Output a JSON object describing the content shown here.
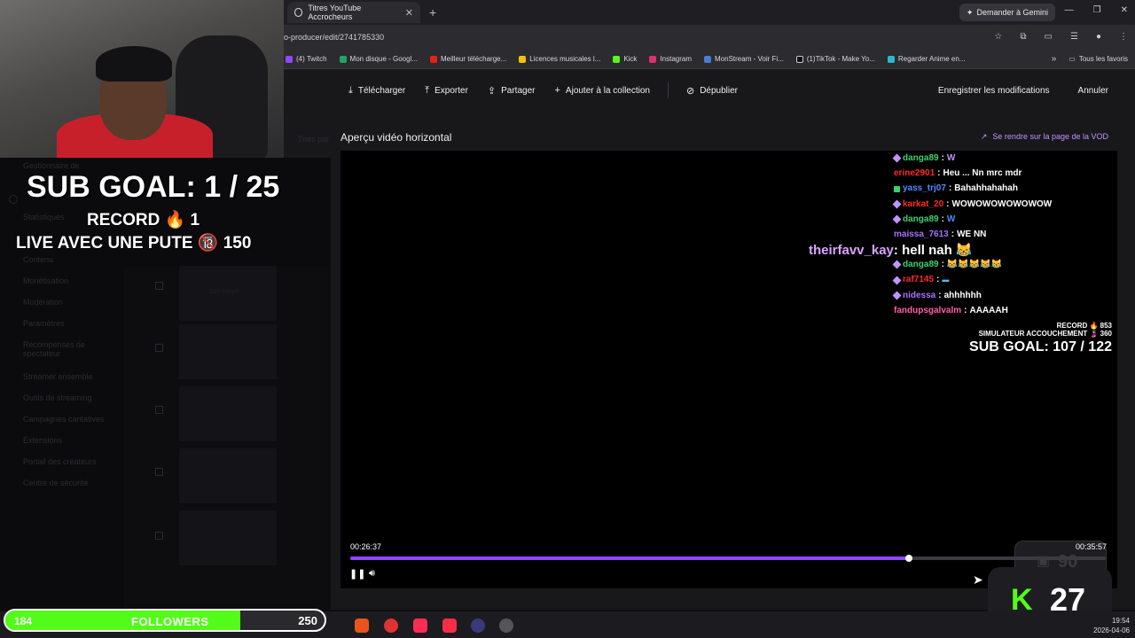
{
  "browser": {
    "tab_title": "Titres YouTube Accrocheurs",
    "gemini_label": "Demander à Gemini",
    "url": "o-producer/edit/2741785330",
    "bookmarks": [
      "(4) Twitch",
      "Mon disque - Googl...",
      "Meilleur télécharge...",
      "Licences musicales l...",
      "Kick",
      "Instagram",
      "MonStream - Voir Fi...",
      "(1)TikTok - Make Yo...",
      "Regarder Anime en..."
    ],
    "all_bookmarks": "Tous les favoris"
  },
  "sidebar": {
    "items": [
      "Gestionnaire de",
      "Statistiques",
      "Contenu",
      "Monétisation",
      "Modération",
      "Paramètres",
      "Récompenses de spectateur",
      "Streamer ensemble",
      "Outils de streaming",
      "Campagnes caritatives",
      "Extensions",
      "Portail des créateurs",
      "Centre de sécurité"
    ],
    "list_header": "Triés par",
    "mute_label": "Son coupé"
  },
  "toolbar": {
    "download": "Télécharger",
    "export": "Exporter",
    "share": "Partager",
    "add_collection": "Ajouter à la collection",
    "unpublish": "Dépublier",
    "save": "Enregistrer les modifications",
    "cancel": "Annuler"
  },
  "preview": {
    "title": "Aperçu vidéo horizontal",
    "vod_link": "Se rendre sur la page de la VOD"
  },
  "chat": [
    {
      "user": "danga89",
      "text": "W",
      "color": "#3bd16f"
    },
    {
      "user": "erine2901",
      "text": "Heu ... Nn mrc mdr",
      "color": "#ff2a2a"
    },
    {
      "user": "yass_trj07",
      "text": "Bahahhahahah",
      "color": "#4f8cff"
    },
    {
      "user": "karkat_20",
      "text": "WOWOWOWOWOWOW",
      "color": "#ff2a2a"
    },
    {
      "user": "danga89",
      "text": "W",
      "color": "#3bd16f"
    },
    {
      "user": "maissa_7613",
      "text": "WE NN",
      "color": "#a970ff"
    },
    {
      "user": "",
      "text": "",
      "color": "#000000"
    },
    {
      "user": "danga89",
      "text": "",
      "color": "#3bd16f"
    },
    {
      "user": "raf7145",
      "text": "",
      "color": "#ff2a2a"
    },
    {
      "user": "nidessa",
      "text": "ahhhhhh",
      "color": "#a970ff"
    },
    {
      "user": "fandupsgalvalm",
      "text": "AAAAAH",
      "color": "#ff5fa8"
    }
  ],
  "float_msg": {
    "user": "theirfavv_kay",
    "text": ": hell nah"
  },
  "video_stats": {
    "record": "RECORD 🔥 853",
    "simulateur": "SIMULATEUR ACCOUCHEMENT 🤰 360",
    "sub_goal": "SUB GOAL: 107 / 122"
  },
  "player": {
    "current_time": "00:26:37",
    "total_time": "00:35:57",
    "progress_fraction": 0.74
  },
  "overlay": {
    "sub_goal": "SUB GOAL: 1 / 25",
    "record": "RECORD 🔥 1",
    "live": "LIVE AVEC UNE PUTE 🔞 150"
  },
  "followers": {
    "current": "184",
    "label": "FOLLOWERS",
    "goal": "250",
    "fraction": 0.736
  },
  "kick": {
    "count": "27"
  },
  "twitch_count": "90",
  "clock": {
    "time": "19:54",
    "date": "2026-04-06"
  }
}
